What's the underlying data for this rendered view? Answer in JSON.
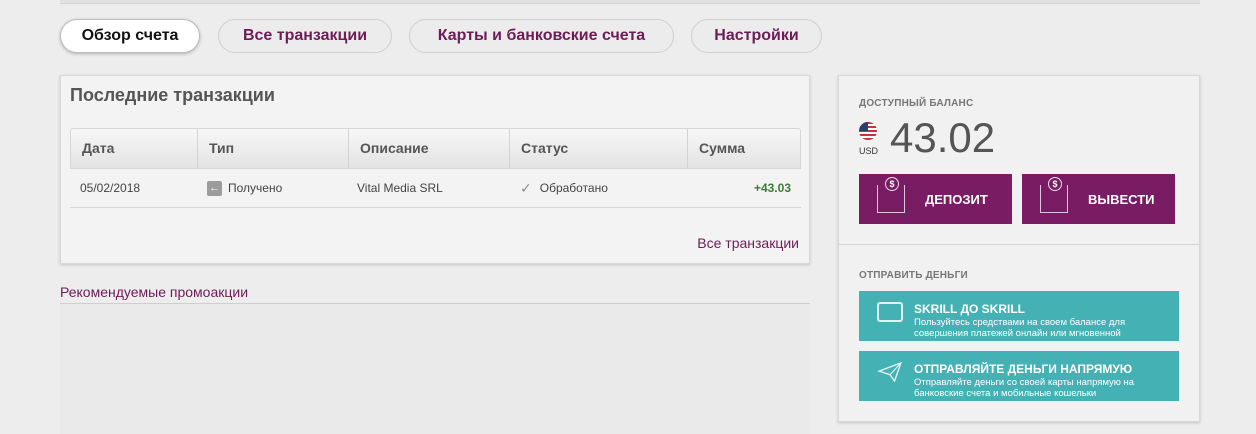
{
  "tabs": [
    {
      "label": "Обзор счета",
      "active": true
    },
    {
      "label": "Все транзакции",
      "active": false
    },
    {
      "label": "Карты и банковские счета",
      "active": false
    },
    {
      "label": "Настройки",
      "active": false
    }
  ],
  "recent": {
    "title": "Последние транзакции",
    "columns": [
      "Дата",
      "Тип",
      "Описание",
      "Статус",
      "Сумма"
    ],
    "rows": [
      {
        "date": "05/02/2018",
        "type": "Получено",
        "description": "Vital Media SRL",
        "status": "Обработано",
        "amount": "+43.03"
      }
    ],
    "all_link": "Все транзакции"
  },
  "promo": {
    "title": "Рекомендуемые промоакции"
  },
  "balance": {
    "caption": "ДОСТУПНЫЙ БАЛАНС",
    "currency": "USD",
    "amount": "43.02",
    "deposit_label": "ДЕПОЗИТ",
    "withdraw_label": "ВЫВЕСТИ"
  },
  "send": {
    "caption": "ОТПРАВИТЬ ДЕНЬГИ",
    "options": [
      {
        "title": "SKRILL ДО SKRILL",
        "desc": "Пользуйтесь средствами на своем балансе для совершения платежей онлайн или мгновенной"
      },
      {
        "title": "ОТПРАВЛЯЙТЕ ДЕНЬГИ НАПРЯМУЮ",
        "desc": "Отправляйте деньги со своей карты напрямую на банковские счета и мобильные кошельки"
      }
    ]
  },
  "colors": {
    "brand_purple": "#7a1c63",
    "teal": "#44b1b5",
    "positive": "#3c7a36"
  }
}
